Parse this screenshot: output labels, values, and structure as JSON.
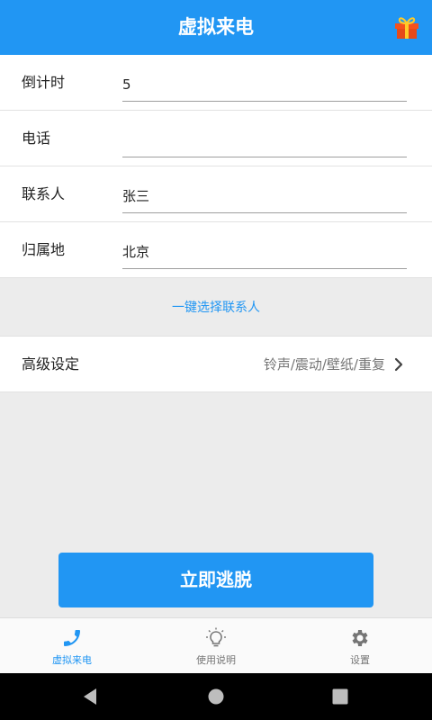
{
  "header": {
    "title": "虚拟来电",
    "gift_icon": "gift-icon"
  },
  "form": {
    "countdown": {
      "label": "倒计时",
      "value": "5",
      "placeholder": ""
    },
    "phone": {
      "label": "电话",
      "value": "",
      "placeholder": ""
    },
    "contact": {
      "label": "联系人",
      "value": "张三",
      "placeholder": ""
    },
    "location": {
      "label": "归属地",
      "value": "北京",
      "placeholder": ""
    }
  },
  "pick_contact": {
    "label": "一键选择联系人"
  },
  "advanced": {
    "label": "高级设定",
    "value": "铃声/震动/壁纸/重复"
  },
  "escape_button": {
    "label": "立即逃脱"
  },
  "tabs": [
    {
      "label": "虚拟来电",
      "icon": "phone-icon",
      "active": true
    },
    {
      "label": "使用说明",
      "icon": "lightbulb-icon",
      "active": false
    },
    {
      "label": "设置",
      "icon": "gear-icon",
      "active": false
    }
  ],
  "colors": {
    "accent": "#2196f3",
    "background": "#ececec",
    "gift": "#f4511e"
  }
}
